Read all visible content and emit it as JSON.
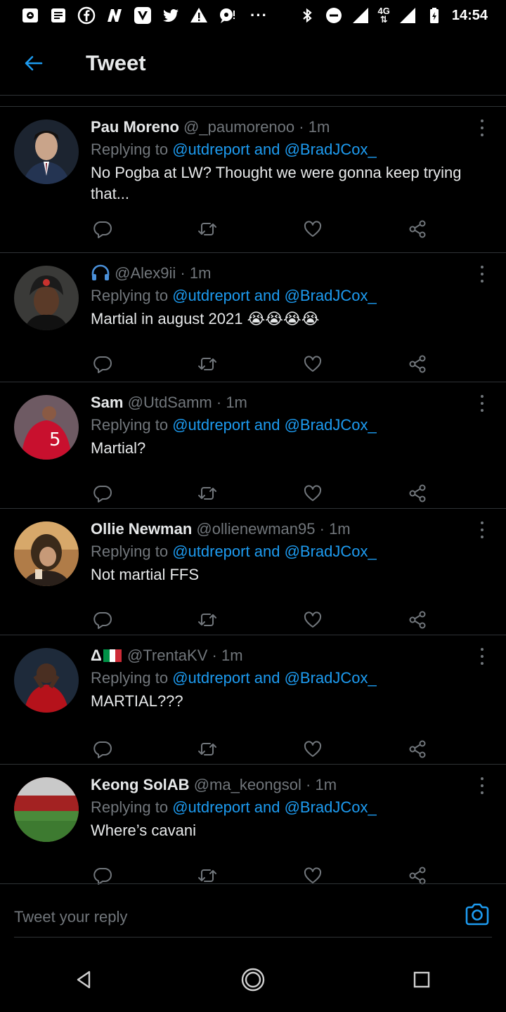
{
  "status_bar": {
    "time": "14:54",
    "network": "4G",
    "left_icons": [
      "app-icon-1",
      "message-icon",
      "facebook-icon",
      "nyt-icon",
      "v-app-icon",
      "twitter-icon",
      "alert-icon",
      "chat-icon"
    ],
    "more": "···"
  },
  "header": {
    "title": "Tweet"
  },
  "tweets": [
    {
      "name": "Pau Moreno",
      "handle": "@_paumorenoo",
      "time": "· 1m",
      "replying_prefix": "Replying to",
      "mention1": "@utdreport",
      "and": "and",
      "mention2": "@BradJCox_",
      "text": "No Pogba at LW? Thought we were gonna keep trying that..."
    },
    {
      "name": "",
      "handle": "@Alex9ii",
      "time": "· 1m",
      "replying_prefix": "Replying to",
      "mention1": "@utdreport",
      "and": "and",
      "mention2": "@BradJCox_",
      "text": "Martial in august 2021",
      "emoji": "😭😭😭😭"
    },
    {
      "name": "Sam",
      "handle": "@UtdSamm",
      "time": "· 1m",
      "replying_prefix": "Replying to",
      "mention1": "@utdreport",
      "and": "and",
      "mention2": "@BradJCox_",
      "text": "Martial?"
    },
    {
      "name": "Ollie Newman",
      "handle": "@ollienewman95",
      "time": "· 1m",
      "replying_prefix": "Replying to",
      "mention1": "@utdreport",
      "and": "and",
      "mention2": "@BradJCox_",
      "text": "Not martial FFS"
    },
    {
      "name": "Δ",
      "handle": "@TrentaKV",
      "time": "· 1m",
      "replying_prefix": "Replying to",
      "mention1": "@utdreport",
      "and": "and",
      "mention2": "@BradJCox_",
      "text": "MARTIAL???"
    },
    {
      "name": "Keong SolAB",
      "handle": "@ma_keongsol",
      "time": "· 1m",
      "replying_prefix": "Replying to",
      "mention1": "@utdreport",
      "and": "and",
      "mention2": "@BradJCox_",
      "text": "Where’s cavani"
    }
  ],
  "reply": {
    "placeholder": "Tweet your reply"
  },
  "colors": {
    "accent": "#1d9bf0",
    "background": "#000000",
    "muted": "#71767b",
    "divider": "#2f3336"
  }
}
